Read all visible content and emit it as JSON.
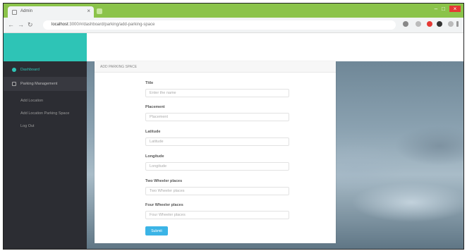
{
  "browser": {
    "tab_title": "Admin",
    "tab_close": "×",
    "url_host": "localhost",
    "url_path": ":3000/#/dashboard/parking/add-parking-space",
    "nav": {
      "back": "←",
      "forward": "→",
      "reload": "↻"
    },
    "window_controls": {
      "minimize": "–",
      "maximize": "□",
      "close": "×"
    }
  },
  "sidebar": {
    "items": [
      {
        "label": "Dashboard",
        "icon": "dashboard-icon"
      },
      {
        "label": "Parking Management",
        "icon": "parking-icon"
      }
    ],
    "subitems": [
      {
        "label": "Add Location"
      },
      {
        "label": "Add Location Parking Space"
      },
      {
        "label": "Log Out"
      }
    ]
  },
  "form": {
    "header": "ADD PARKING SPACE",
    "fields": [
      {
        "label": "Title",
        "placeholder": "Enter the name"
      },
      {
        "label": "Placement",
        "placeholder": "Placement"
      },
      {
        "label": "Latitude",
        "placeholder": "Latitude"
      },
      {
        "label": "Longitude",
        "placeholder": "Longitude"
      },
      {
        "label": "Two Wheeler places",
        "placeholder": "Two Wheeler places"
      },
      {
        "label": "Four Wheeler places",
        "placeholder": "Four Wheeler places"
      }
    ],
    "submit_label": "Submit"
  },
  "colors": {
    "brand": "#2ec4b6",
    "sidebar": "#2c2d33",
    "browser_bar": "#8bc34a",
    "button": "#3bb4e6"
  }
}
